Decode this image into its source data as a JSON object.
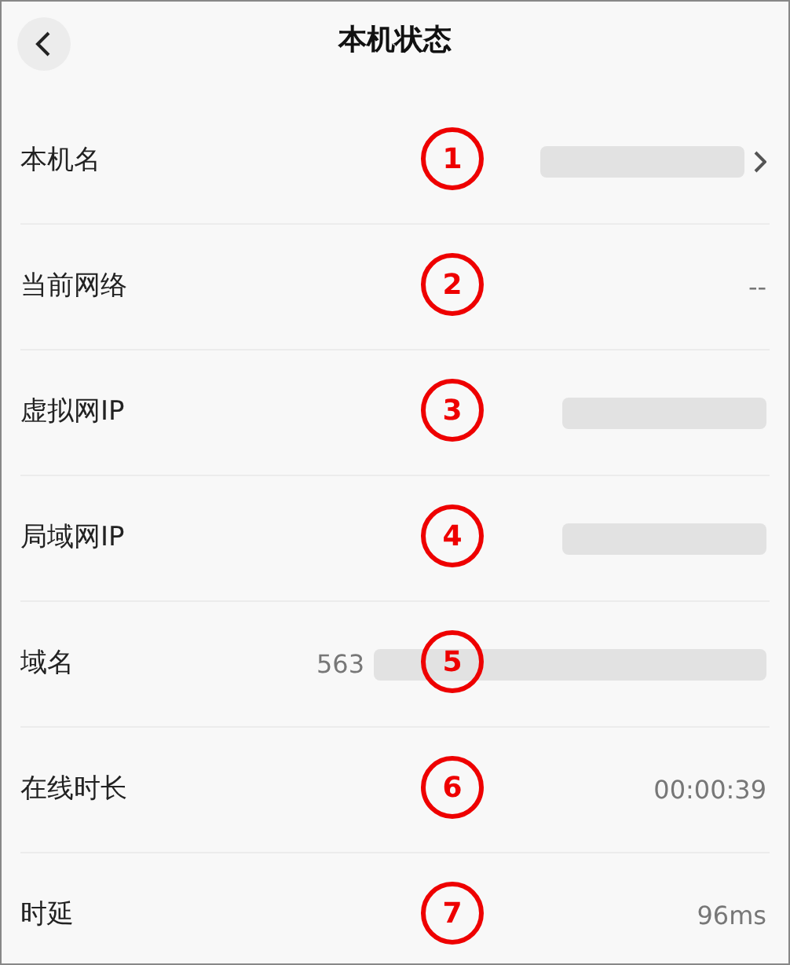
{
  "header": {
    "title": "本机状态"
  },
  "rows": [
    {
      "label": "本机名",
      "marker": "1",
      "kind": "redacted",
      "chevron": true
    },
    {
      "label": "当前网络",
      "marker": "2",
      "kind": "text",
      "value": "--",
      "chevron": false
    },
    {
      "label": "虚拟网IP",
      "marker": "3",
      "kind": "redacted",
      "chevron": false
    },
    {
      "label": "局域网IP",
      "marker": "4",
      "kind": "redacted",
      "chevron": false
    },
    {
      "label": "域名",
      "marker": "5",
      "kind": "redacted",
      "prefix": "563",
      "chevron": false
    },
    {
      "label": "在线时长",
      "marker": "6",
      "kind": "text",
      "value": "00:00:39",
      "chevron": false
    },
    {
      "label": "时延",
      "marker": "7",
      "kind": "text",
      "value": "96ms",
      "chevron": false
    }
  ]
}
